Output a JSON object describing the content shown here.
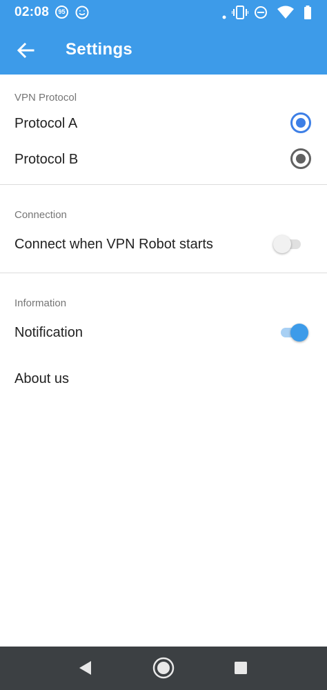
{
  "status_bar": {
    "time": "02:08",
    "badge": "95",
    "icons": [
      "notification-badge-icon",
      "smiley-icon",
      "dot-icon",
      "vibrate-icon",
      "do-not-disturb-icon",
      "wifi-icon",
      "battery-icon"
    ]
  },
  "app_bar": {
    "title": "Settings",
    "back_icon": "arrow-left-icon",
    "color": "#3d9be9"
  },
  "sections": {
    "vpn_protocol": {
      "label": "VPN Protocol",
      "options": [
        {
          "label": "Protocol A",
          "selected": true
        },
        {
          "label": "Protocol B",
          "selected": false
        }
      ]
    },
    "connection": {
      "label": "Connection",
      "connect_on_start": {
        "label": "Connect when VPN Robot starts",
        "enabled": false
      }
    },
    "information": {
      "label": "Information",
      "notification": {
        "label": "Notification",
        "enabled": true
      },
      "about": {
        "label": "About us"
      }
    }
  },
  "nav_bar": {
    "buttons": [
      "back-triangle-icon",
      "home-circle-icon",
      "recents-square-icon"
    ]
  }
}
